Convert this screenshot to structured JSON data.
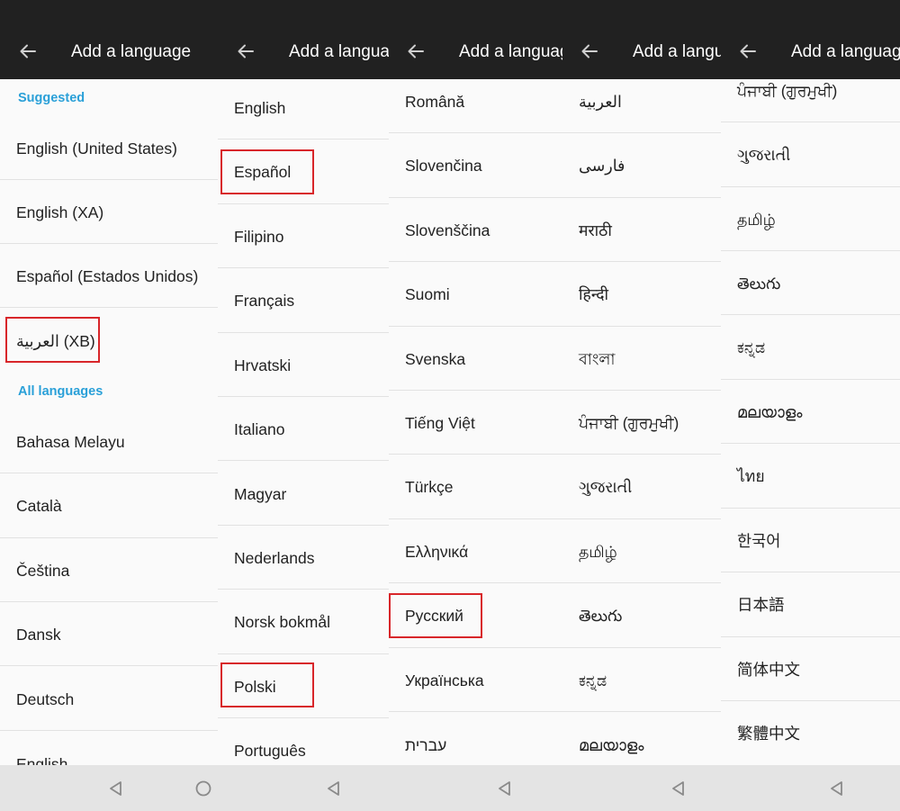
{
  "header": {
    "title": "Add a language"
  },
  "panel1": {
    "suggested_label": "Suggested",
    "all_languages_label": "All languages",
    "suggested_items": [
      "English (United States)",
      "English (XA)",
      "Español (Estados Unidos)",
      "العربية (XB)"
    ],
    "all_items": [
      "Bahasa Melayu",
      "Català",
      "Čeština",
      "Dansk",
      "Deutsch",
      "English"
    ]
  },
  "panel2": {
    "items": [
      "English",
      "Español",
      "Filipino",
      "Français",
      "Hrvatski",
      "Italiano",
      "Magyar",
      "Nederlands",
      "Norsk bokmål",
      "Polski",
      "Português"
    ]
  },
  "panel3": {
    "items": [
      "Română",
      "Slovenčina",
      "Slovenščina",
      "Suomi",
      "Svenska",
      "Tiếng Việt",
      "Türkçe",
      "Ελληνικά",
      "Русский",
      "Українська",
      "עברית"
    ]
  },
  "panel4": {
    "items": [
      "العربية",
      "فارسی",
      "मराठी",
      "हिन्दी",
      "বাংলা",
      "ਪੰਜਾਬੀ (ਗੁਰਮੁਖੀ)",
      "ગુજરાતી",
      "தமிழ்",
      "తెలుగు",
      "ಕನ್ನಡ",
      "മലയാളം"
    ]
  },
  "panel5": {
    "items": [
      "ਪੰਜਾਬੀ (ਗੁਰਮੁਖੀ)",
      "ગુજરાતી",
      "தமிழ்",
      "తెలుగు",
      "ಕನ್ನಡ",
      "മലയാളം",
      "ไทย",
      "한국어",
      "日本語",
      "简体中文",
      "繁體中文"
    ]
  },
  "highlighted_items": [
    "العربية (XB)",
    "Español",
    "Polski",
    "Русский"
  ],
  "icons": {
    "back": "back-arrow-icon",
    "nav_back": "nav-back-triangle-icon",
    "nav_home": "nav-home-circle-icon"
  },
  "colors": {
    "app_bar": "#212121",
    "section_label": "#2aa0d8",
    "highlight": "#d8262a",
    "nav_bar": "#e4e4e4"
  }
}
